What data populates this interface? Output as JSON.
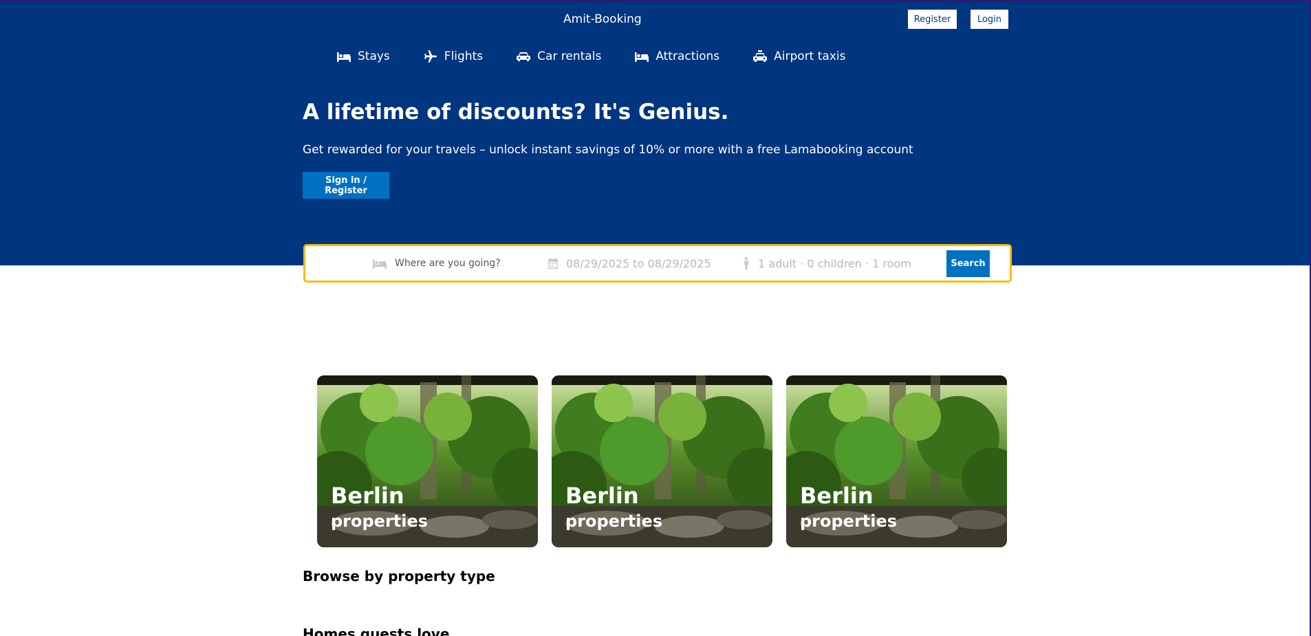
{
  "header": {
    "brand": "Amit-Booking",
    "register_label": "Register",
    "login_label": "Login"
  },
  "nav": {
    "items": [
      {
        "label": "Stays",
        "icon": "bed-icon"
      },
      {
        "label": "Flights",
        "icon": "plane-icon"
      },
      {
        "label": "Car rentals",
        "icon": "car-icon"
      },
      {
        "label": "Attractions",
        "icon": "bed-icon"
      },
      {
        "label": "Airport taxis",
        "icon": "taxi-icon"
      }
    ]
  },
  "hero": {
    "title": "A lifetime of discounts? It's Genius.",
    "subtitle": "Get rewarded for your travels – unlock instant savings of 10% or more with a free Lamabooking account",
    "cta_label": "Sign in / Register"
  },
  "search": {
    "destination_placeholder": "Where are you going?",
    "dates": "08/29/2025 to 08/29/2025",
    "guests": "1 adult · 0 children · 1 room",
    "button_label": "Search"
  },
  "featured": [
    {
      "city": "Berlin",
      "subtitle": "properties"
    },
    {
      "city": "Berlin",
      "subtitle": "properties"
    },
    {
      "city": "Berlin",
      "subtitle": "properties"
    }
  ],
  "sections": {
    "property_type_title": "Browse by property type",
    "homes_title": "Homes guests love"
  },
  "colors": {
    "primary": "#003580",
    "button": "#0071c2",
    "searchbar_border": "#febb02"
  }
}
